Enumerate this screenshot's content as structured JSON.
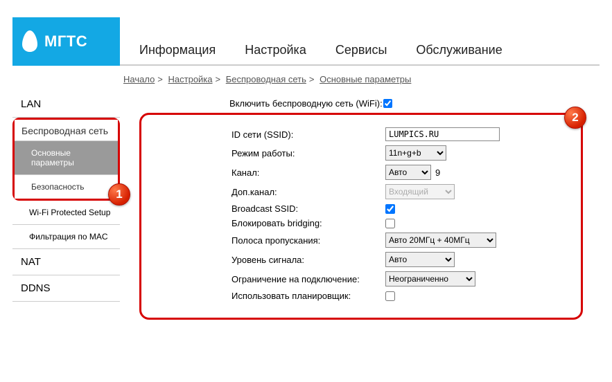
{
  "brand": "МГТС",
  "topnav": {
    "info": "Информация",
    "setup": "Настройка",
    "services": "Сервисы",
    "maintenance": "Обслуживание"
  },
  "breadcrumb": {
    "home": "Начало",
    "setup": "Настройка",
    "wireless": "Беспроводная сеть",
    "basic": "Основные параметры"
  },
  "sidebar": {
    "lan": "LAN",
    "wireless": "Беспроводная сеть",
    "basic": "Основные параметры",
    "security": "Безопасность",
    "wps": "Wi-Fi Protected Setup",
    "macfilter": "Фильтрация по MAC",
    "nat": "NAT",
    "ddns": "DDNS"
  },
  "form": {
    "enable_wifi_label": "Включить беспроводную сеть (WiFi):",
    "ssid_label": "ID сети (SSID):",
    "ssid_value": "LUMPICS.RU",
    "mode_label": "Режим работы:",
    "mode_value": "11n+g+b",
    "channel_label": "Канал:",
    "channel_value": "Авто",
    "channel_current": "9",
    "extchannel_label": "Доп.канал:",
    "extchannel_value": "Входящий",
    "broadcast_label": "Broadcast SSID:",
    "bridging_label": "Блокировать bridging:",
    "bandwidth_label": "Полоса пропускания:",
    "bandwidth_value": "Авто 20МГц + 40МГц",
    "signal_label": "Уровень сигнала:",
    "signal_value": "Авто",
    "limit_label": "Ограничение на подключение:",
    "limit_value": "Неограниченно",
    "scheduler_label": "Использовать планировщик:"
  },
  "badges": {
    "one": "1",
    "two": "2"
  }
}
